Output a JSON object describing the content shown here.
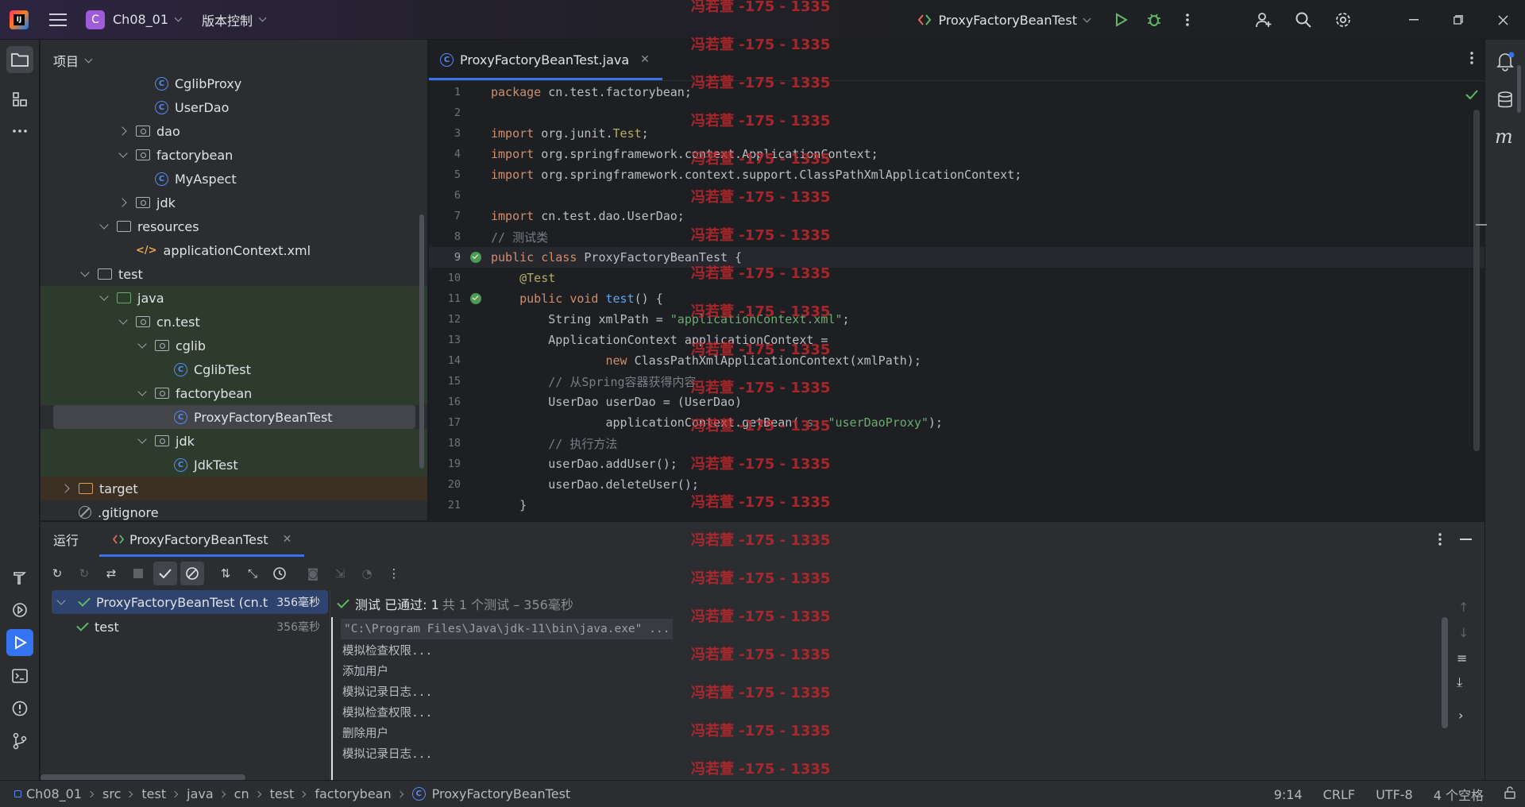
{
  "titlebar": {
    "project_badge": "C",
    "project_name": "Ch08_01",
    "vcs_menu": "版本控制",
    "run_config": "ProxyFactoryBeanTest"
  },
  "project_panel": {
    "title": "项目",
    "tree": [
      {
        "label": "CglibProxy",
        "kind": "class",
        "depth": 4,
        "arrow": "none",
        "bg": "none"
      },
      {
        "label": "UserDao",
        "kind": "class",
        "depth": 4,
        "arrow": "none",
        "bg": "none"
      },
      {
        "label": "dao",
        "kind": "package",
        "depth": 3,
        "arrow": "right",
        "bg": "none"
      },
      {
        "label": "factorybean",
        "kind": "package",
        "depth": 3,
        "arrow": "down",
        "bg": "none"
      },
      {
        "label": "MyAspect",
        "kind": "class",
        "depth": 4,
        "arrow": "none",
        "bg": "none"
      },
      {
        "label": "jdk",
        "kind": "package",
        "depth": 3,
        "arrow": "right",
        "bg": "none"
      },
      {
        "label": "resources",
        "kind": "folder",
        "depth": 2,
        "arrow": "down",
        "bg": "none"
      },
      {
        "label": "applicationContext.xml",
        "kind": "xml",
        "depth": 3,
        "arrow": "none",
        "bg": "none"
      },
      {
        "label": "test",
        "kind": "folder",
        "depth": 1,
        "arrow": "down",
        "bg": "none"
      },
      {
        "label": "java",
        "kind": "folder-green",
        "depth": 2,
        "arrow": "down",
        "bg": "test"
      },
      {
        "label": "cn.test",
        "kind": "package",
        "depth": 3,
        "arrow": "down",
        "bg": "test"
      },
      {
        "label": "cglib",
        "kind": "package",
        "depth": 4,
        "arrow": "down",
        "bg": "test"
      },
      {
        "label": "CglibTest",
        "kind": "class",
        "depth": 5,
        "arrow": "none",
        "bg": "test"
      },
      {
        "label": "factorybean",
        "kind": "package",
        "depth": 4,
        "arrow": "down",
        "bg": "test"
      },
      {
        "label": "ProxyFactoryBeanTest",
        "kind": "class",
        "depth": 5,
        "arrow": "none",
        "bg": "selected"
      },
      {
        "label": "jdk",
        "kind": "package",
        "depth": 4,
        "arrow": "down",
        "bg": "test"
      },
      {
        "label": "JdkTest",
        "kind": "class",
        "depth": 5,
        "arrow": "none",
        "bg": "test"
      },
      {
        "label": "target",
        "kind": "folder-orange",
        "depth": 0,
        "arrow": "right",
        "bg": "target"
      },
      {
        "label": ".gitignore",
        "kind": "git",
        "depth": 0,
        "arrow": "none",
        "bg": "none"
      }
    ]
  },
  "editor": {
    "tab_label": "ProxyFactoryBeanTest.java",
    "current_line": 9,
    "lines": [
      {
        "n": "1",
        "segs": [
          [
            "kw",
            "package"
          ],
          [
            "t",
            " cn.test.factorybean;"
          ]
        ]
      },
      {
        "n": "2",
        "segs": []
      },
      {
        "n": "3",
        "segs": [
          [
            "kw",
            "import"
          ],
          [
            "t",
            " org.junit."
          ],
          [
            "ann",
            "Test"
          ],
          [
            "t",
            ";"
          ]
        ]
      },
      {
        "n": "4",
        "segs": [
          [
            "kw",
            "import"
          ],
          [
            "t",
            " org.springframework.context.ApplicationContext;"
          ]
        ]
      },
      {
        "n": "5",
        "segs": [
          [
            "kw",
            "import"
          ],
          [
            "t",
            " org.springframework.context.support.ClassPathXmlApplicationContext;"
          ]
        ]
      },
      {
        "n": "6",
        "segs": []
      },
      {
        "n": "7",
        "segs": [
          [
            "kw",
            "import"
          ],
          [
            "t",
            " cn.test.dao.UserDao;"
          ]
        ]
      },
      {
        "n": "8",
        "segs": [
          [
            "cm",
            "// 测试类"
          ]
        ]
      },
      {
        "n": "9",
        "segs": [
          [
            "kw",
            "public class"
          ],
          [
            "t",
            " ProxyFactoryBeanTest {"
          ]
        ],
        "run": true
      },
      {
        "n": "10",
        "segs": [
          [
            "t",
            "    "
          ],
          [
            "ann",
            "@Test"
          ]
        ]
      },
      {
        "n": "11",
        "segs": [
          [
            "t",
            "    "
          ],
          [
            "kw",
            "public void"
          ],
          [
            "t",
            " "
          ],
          [
            "fn",
            "test"
          ],
          [
            "t",
            "() {"
          ]
        ],
        "run": true
      },
      {
        "n": "12",
        "segs": [
          [
            "t",
            "        String xmlPath = "
          ],
          [
            "str",
            "\"applicationContext.xml\""
          ],
          [
            "t",
            ";"
          ]
        ]
      },
      {
        "n": "13",
        "segs": [
          [
            "t",
            "        ApplicationContext applicationContext ="
          ]
        ]
      },
      {
        "n": "14",
        "segs": [
          [
            "t",
            "                "
          ],
          [
            "kw",
            "new"
          ],
          [
            "t",
            " ClassPathXmlApplicationContext(xmlPath);"
          ]
        ]
      },
      {
        "n": "15",
        "segs": [
          [
            "t",
            "        "
          ],
          [
            "cm",
            "// 从Spring容器获得内容"
          ]
        ]
      },
      {
        "n": "16",
        "segs": [
          [
            "t",
            "        UserDao userDao = (UserDao)"
          ]
        ]
      },
      {
        "n": "17",
        "segs": [
          [
            "t",
            "                applicationContext.getBean( "
          ],
          [
            "cm",
            "s:"
          ],
          [
            "t",
            " "
          ],
          [
            "str",
            "\"userDaoProxy\""
          ],
          [
            "t",
            ");"
          ]
        ]
      },
      {
        "n": "18",
        "segs": [
          [
            "t",
            "        "
          ],
          [
            "cm",
            "// 执行方法"
          ]
        ]
      },
      {
        "n": "19",
        "segs": [
          [
            "t",
            "        userDao.addUser();"
          ]
        ]
      },
      {
        "n": "20",
        "segs": [
          [
            "t",
            "        userDao.deleteUser();"
          ]
        ]
      },
      {
        "n": "21",
        "segs": [
          [
            "t",
            "    }"
          ]
        ]
      }
    ]
  },
  "run_panel": {
    "title": "运行",
    "tab_label": "ProxyFactoryBeanTest",
    "tests": [
      {
        "label": "ProxyFactoryBeanTest (cn.t",
        "duration": "356毫秒"
      },
      {
        "label": "test",
        "duration": "356毫秒"
      }
    ],
    "status_main": "测试 已通过: 1",
    "status_sub": "共 1 个测试 – 356毫秒",
    "console": [
      "\"C:\\Program Files\\Java\\jdk-11\\bin\\java.exe\" ...",
      "模拟检查权限...",
      "添加用户",
      "模拟记录日志...",
      "模拟检查权限...",
      "删除用户",
      "模拟记录日志..."
    ]
  },
  "statusbar": {
    "breadcrumb": [
      "Ch08_01",
      "src",
      "test",
      "java",
      "cn",
      "test",
      "factorybean",
      "ProxyFactoryBeanTest"
    ],
    "position": "9:14",
    "line_sep": "CRLF",
    "encoding": "UTF-8",
    "indent": "4 个空格"
  },
  "watermark": "冯若萱 -175 - 1335",
  "colors": {
    "accent": "#3574f0",
    "pass": "#5fb865",
    "watermark": "#c1272d"
  }
}
